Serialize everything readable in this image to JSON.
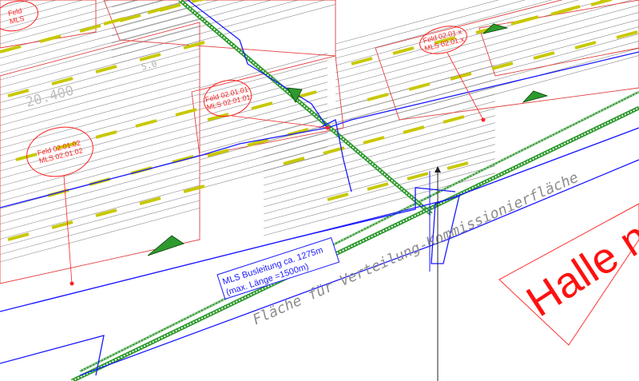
{
  "drawing": {
    "hall_label": "Halle ne",
    "busline_label_line1": "MLS Busleitung ca. 1275m",
    "busline_label_line2": "(max. Länge =1500m)",
    "dimension_left": "20.400",
    "dimension_top": "5.0",
    "area_label": "Fläche für Verteilung-Kommissionierfläche",
    "field_tags": [
      {
        "line1": "Feld 02.01.02",
        "line2": "MLS 02.01.02"
      },
      {
        "line1": "Feld 02.01.01",
        "line2": "MLS 02.01.01"
      },
      {
        "line1": "Feld 02.01.x",
        "line2": "MLS 02.01.x"
      },
      {
        "line1": "Feld",
        "line2": "MLS"
      }
    ]
  },
  "colors": {
    "rack_line": "#8a8a8a",
    "field_border": "#e04040",
    "bus_line": "#1a1aff",
    "cable_tray": "#2e9a2e",
    "lamp": "#c8c800",
    "tag": "#ff2020",
    "text": "#303030"
  }
}
